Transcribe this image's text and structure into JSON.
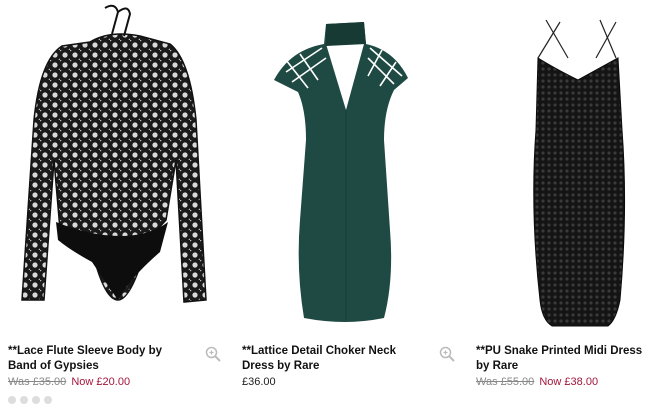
{
  "products": [
    {
      "title": "**Lace Flute Sleeve Body by Band of Gypsies",
      "was_price": "Was £35.00",
      "now_price": "Now £20.00",
      "image_icon": "lace-bodysuit-photo",
      "has_zoom": true
    },
    {
      "title": "**Lattice Detail Choker Neck Dress by Rare",
      "price": "£36.00",
      "image_icon": "green-lattice-dress-photo",
      "has_zoom": true
    },
    {
      "title": "**PU Snake Printed Midi Dress by Rare",
      "was_price": "Was £55.00",
      "now_price": "Now £38.00",
      "image_icon": "black-snake-midi-dress-photo",
      "has_zoom": false
    }
  ],
  "colors": {
    "sale": "#a3163a",
    "was": "#888888",
    "green_dress": "#1f4a43",
    "black": "#111111"
  }
}
